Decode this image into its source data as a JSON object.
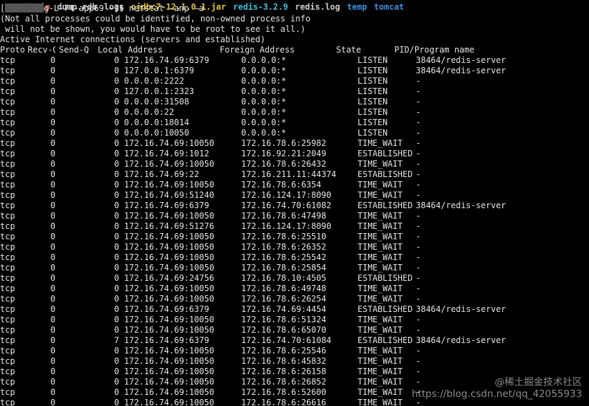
{
  "top_strip": [
    {
      "text": "ub/zip",
      "color": "#e05555"
    },
    {
      "text": "dump.rdb",
      "color": "#d0d0d0"
    },
    {
      "text": "logs",
      "color": "#d0d0d0"
    },
    {
      "text": "ojdbc7-12.1.0.1.jar",
      "color": "#e0c040"
    },
    {
      "text": "redis-3.2.9",
      "color": "#40c0e0"
    },
    {
      "text": "redis.log",
      "color": "#d0d0d0"
    },
    {
      "text": "temp",
      "color": "#4090e0"
    },
    {
      "text": "tomcat",
      "color": "#4090e0"
    }
  ],
  "prompt": {
    "open": "[",
    "host_tail": "g-L-74-app",
    "host_end": "69 ~]$ ",
    "command": "netstat -anp -a"
  },
  "messages": [
    "(Not all processes could be identified, non-owned process info",
    " will not be shown, you would have to be root to see it all.)",
    "Active Internet connections (servers and established)"
  ],
  "table": {
    "headers": [
      "Proto",
      "Recv-Q",
      "Send-Q",
      "Local Address",
      "Foreign Address",
      "State",
      "PID/Program name"
    ],
    "rows": [
      [
        "tcp",
        "0",
        "0",
        "172.16.74.69:6379",
        "0.0.0.0:*",
        "LISTEN",
        "38464/redis-server"
      ],
      [
        "tcp",
        "0",
        "0",
        "127.0.0.1:6379",
        "0.0.0.0:*",
        "LISTEN",
        "38464/redis-server"
      ],
      [
        "tcp",
        "0",
        "0",
        "0.0.0.0:2222",
        "0.0.0.0:*",
        "LISTEN",
        "-"
      ],
      [
        "tcp",
        "0",
        "0",
        "127.0.0.1:2323",
        "0.0.0.0:*",
        "LISTEN",
        "-"
      ],
      [
        "tcp",
        "0",
        "0",
        "0.0.0.0:31508",
        "0.0.0.0:*",
        "LISTEN",
        "-"
      ],
      [
        "tcp",
        "0",
        "0",
        "0.0.0.0:22",
        "0.0.0.0:*",
        "LISTEN",
        "-"
      ],
      [
        "tcp",
        "0",
        "0",
        "0.0.0.0:18014",
        "0.0.0.0:*",
        "LISTEN",
        "-"
      ],
      [
        "tcp",
        "0",
        "0",
        "0.0.0.0:10050",
        "0.0.0.0:*",
        "LISTEN",
        "-"
      ],
      [
        "tcp",
        "0",
        "0",
        "172.16.74.69:10050",
        "172.16.78.6:25982",
        "TIME_WAIT",
        "-"
      ],
      [
        "tcp",
        "0",
        "0",
        "172.16.74.69:1012",
        "172.16.92.21:2049",
        "ESTABLISHED",
        "-"
      ],
      [
        "tcp",
        "0",
        "0",
        "172.16.74.69:10050",
        "172.16.78.6:26432",
        "TIME_WAIT",
        "-"
      ],
      [
        "tcp",
        "0",
        "0",
        "172.16.74.69:22",
        "172.16.211.11:44374",
        "ESTABLISHED",
        "-"
      ],
      [
        "tcp",
        "0",
        "0",
        "172.16.74.69:10050",
        "172.16.78.6:6354",
        "TIME_WAIT",
        "-"
      ],
      [
        "tcp",
        "0",
        "0",
        "172.16.74.69:51240",
        "172.16.124.17:8090",
        "TIME_WAIT",
        "-"
      ],
      [
        "tcp",
        "0",
        "0",
        "172.16.74.69:6379",
        "172.16.74.70:61082",
        "ESTABLISHED",
        "38464/redis-server"
      ],
      [
        "tcp",
        "0",
        "0",
        "172.16.74.69:10050",
        "172.16.78.6:47498",
        "TIME_WAIT",
        "-"
      ],
      [
        "tcp",
        "0",
        "0",
        "172.16.74.69:51276",
        "172.16.124.17:8090",
        "TIME_WAIT",
        "-"
      ],
      [
        "tcp",
        "0",
        "0",
        "172.16.74.69:10050",
        "172.16.78.6:25510",
        "TIME_WAIT",
        "-"
      ],
      [
        "tcp",
        "0",
        "0",
        "172.16.74.69:10050",
        "172.16.78.6:26352",
        "TIME_WAIT",
        "-"
      ],
      [
        "tcp",
        "0",
        "0",
        "172.16.74.69:10050",
        "172.16.78.6:25542",
        "TIME_WAIT",
        "-"
      ],
      [
        "tcp",
        "0",
        "0",
        "172.16.74.69:10050",
        "172.16.78.6:25854",
        "TIME_WAIT",
        "-"
      ],
      [
        "tcp",
        "0",
        "0",
        "172.16.74.69:24756",
        "172.16.78.10:4505",
        "ESTABLISHED",
        "-"
      ],
      [
        "tcp",
        "0",
        "0",
        "172.16.74.69:10050",
        "172.16.78.6:49748",
        "TIME_WAIT",
        "-"
      ],
      [
        "tcp",
        "0",
        "0",
        "172.16.74.69:10050",
        "172.16.78.6:26254",
        "TIME_WAIT",
        "-"
      ],
      [
        "tcp",
        "0",
        "0",
        "172.16.74.69:6379",
        "172.16.74.69:4454",
        "ESTABLISHED",
        "38464/redis-server"
      ],
      [
        "tcp",
        "0",
        "0",
        "172.16.74.69:10050",
        "172.16.78.6:51324",
        "TIME_WAIT",
        "-"
      ],
      [
        "tcp",
        "0",
        "0",
        "172.16.74.69:10050",
        "172.16.78.6:65070",
        "TIME_WAIT",
        "-"
      ],
      [
        "tcp",
        "0",
        "7",
        "172.16.74.69:6379",
        "172.16.74.70:61084",
        "ESTABLISHED",
        "38464/redis-server"
      ],
      [
        "tcp",
        "0",
        "0",
        "172.16.74.69:10050",
        "172.16.78.6:25546",
        "TIME_WAIT",
        "-"
      ],
      [
        "tcp",
        "0",
        "0",
        "172.16.74.69:10050",
        "172.16.78.6:45832",
        "TIME_WAIT",
        "-"
      ],
      [
        "tcp",
        "0",
        "0",
        "172.16.74.69:10050",
        "172.16.78.6:26158",
        "TIME_WAIT",
        "-"
      ],
      [
        "tcp",
        "0",
        "0",
        "172.16.74.69:10050",
        "172.16.78.6:26852",
        "TIME_WAIT",
        "-"
      ],
      [
        "tcp",
        "0",
        "0",
        "172.16.74.69:10050",
        "172.16.78.6:52600",
        "TIME_WAIT",
        "-"
      ],
      [
        "tcp",
        "0",
        "0",
        "172.16.74.69:10050",
        "172.16.78.6:26616",
        "TIME_WAIT",
        "-"
      ]
    ]
  },
  "watermark": {
    "line1": "@稀土掘金技术社区",
    "line2": "https://blog.csdn.net/qq_42055933"
  },
  "colors": {
    "background": "#000000",
    "foreground": "#e6e6e6"
  }
}
